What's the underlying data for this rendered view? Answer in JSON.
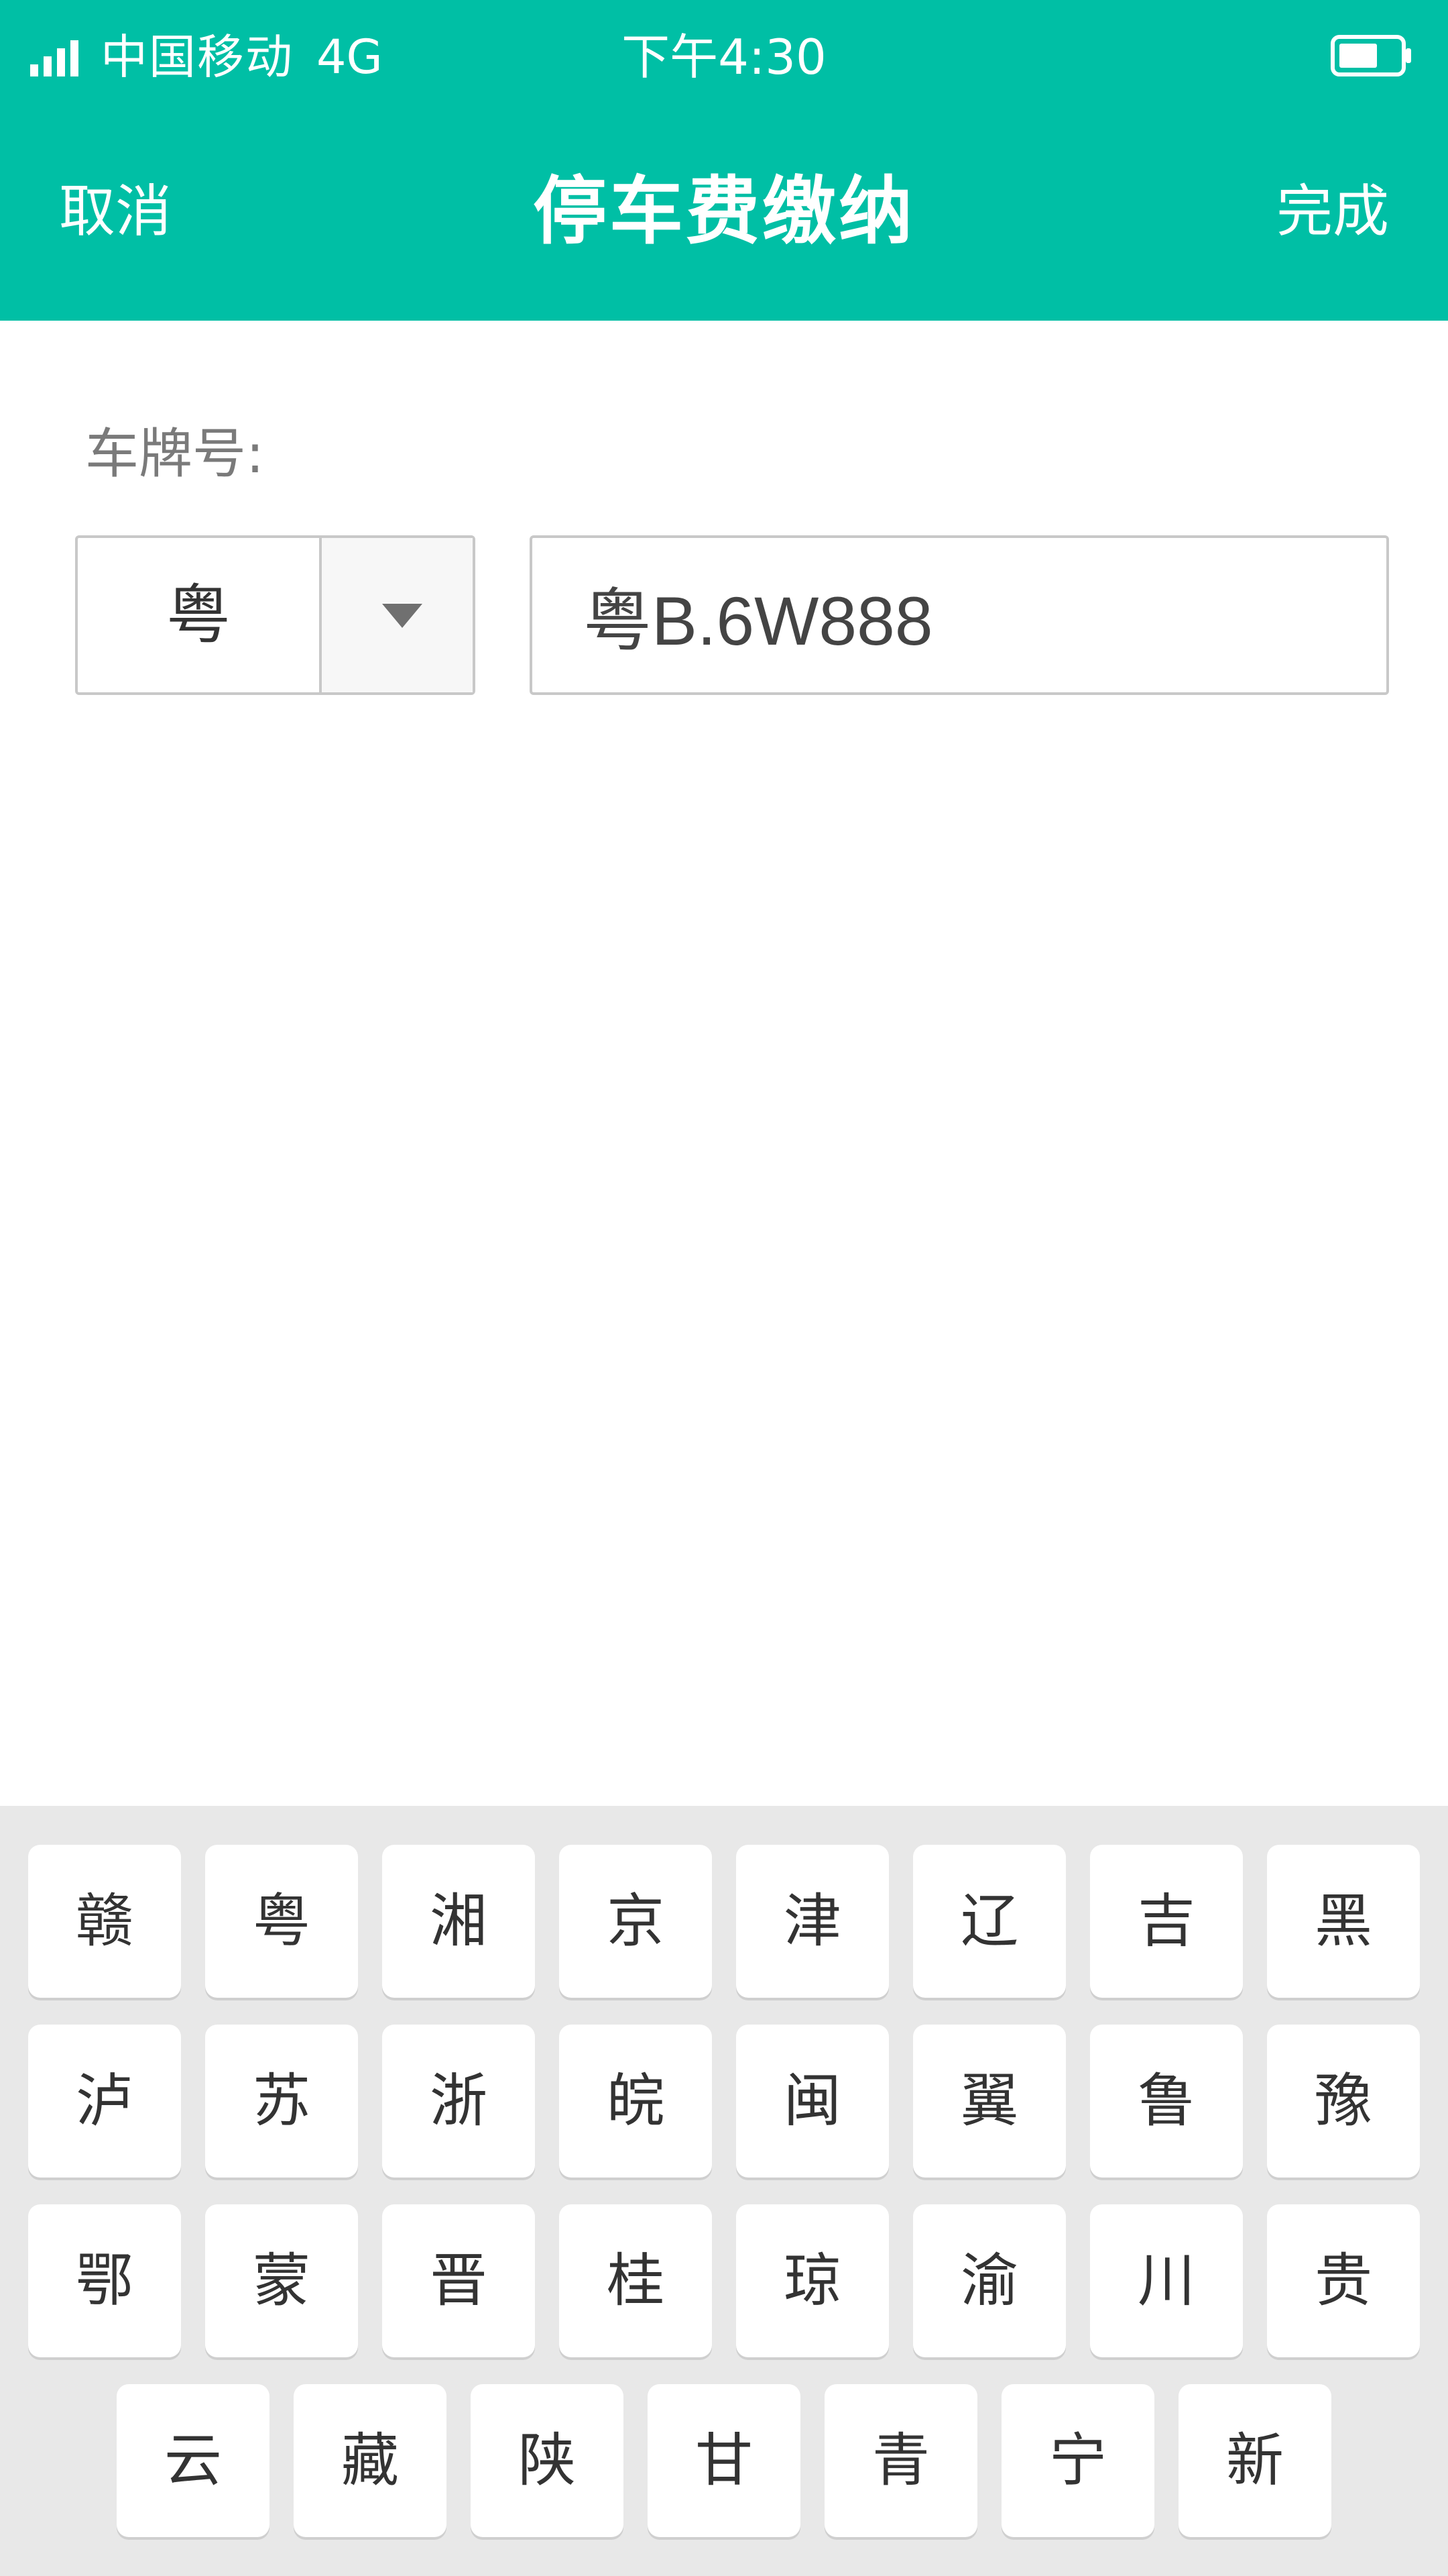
{
  "status_bar": {
    "carrier": "中国移动",
    "network": "4G",
    "time": "下午4:30",
    "signal_icon": "signal-bars-icon",
    "battery_icon": "battery-icon"
  },
  "nav": {
    "cancel_label": "取消",
    "title": "停车费缴纳",
    "done_label": "完成"
  },
  "form": {
    "plate_label": "车牌号:",
    "province_value": "粤",
    "dropdown_icon": "chevron-down-icon",
    "plate_value": "粤B.6W888"
  },
  "keyboard": {
    "rows": [
      [
        "赣",
        "粤",
        "湘",
        "京",
        "津",
        "辽",
        "吉",
        "黑"
      ],
      [
        "泸",
        "苏",
        "浙",
        "皖",
        "闽",
        "翼",
        "鲁",
        "豫"
      ],
      [
        "鄂",
        "蒙",
        "晋",
        "桂",
        "琼",
        "渝",
        "川",
        "贵"
      ],
      [
        "云",
        "藏",
        "陕",
        "甘",
        "青",
        "宁",
        "新"
      ]
    ]
  },
  "colors": {
    "header_bg": "#00bfa5",
    "keyboard_bg": "#e8e8e8"
  }
}
